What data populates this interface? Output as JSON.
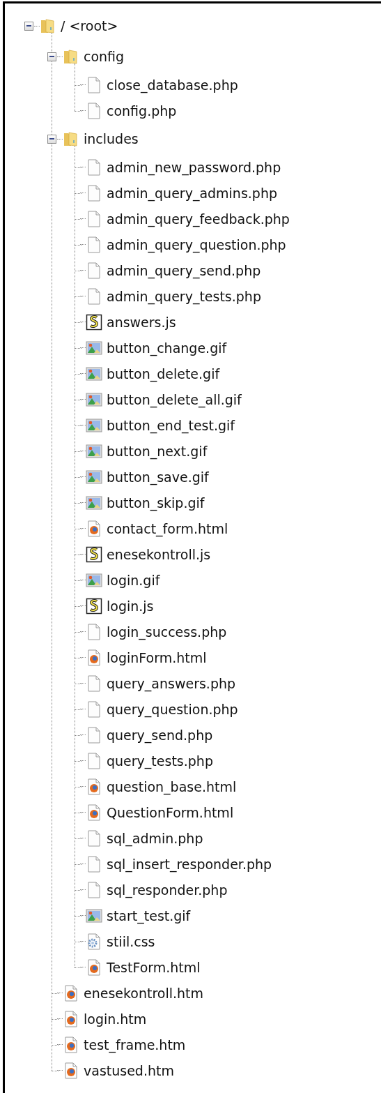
{
  "tree": {
    "label": "/ <root>",
    "kind": "folder",
    "expanded": true,
    "children": [
      {
        "label": "config",
        "kind": "folder",
        "expanded": true,
        "children": [
          {
            "label": "close_database.php",
            "kind": "php"
          },
          {
            "label": "config.php",
            "kind": "php"
          }
        ]
      },
      {
        "label": "includes",
        "kind": "folder",
        "expanded": true,
        "children": [
          {
            "label": "admin_new_password.php",
            "kind": "php"
          },
          {
            "label": "admin_query_admins.php",
            "kind": "php"
          },
          {
            "label": "admin_query_feedback.php",
            "kind": "php"
          },
          {
            "label": "admin_query_question.php",
            "kind": "php"
          },
          {
            "label": "admin_query_send.php",
            "kind": "php"
          },
          {
            "label": "admin_query_tests.php",
            "kind": "php"
          },
          {
            "label": "answers.js",
            "kind": "js"
          },
          {
            "label": "button_change.gif",
            "kind": "gif"
          },
          {
            "label": "button_delete.gif",
            "kind": "gif"
          },
          {
            "label": "button_delete_all.gif",
            "kind": "gif"
          },
          {
            "label": "button_end_test.gif",
            "kind": "gif"
          },
          {
            "label": "button_next.gif",
            "kind": "gif"
          },
          {
            "label": "button_save.gif",
            "kind": "gif"
          },
          {
            "label": "button_skip.gif",
            "kind": "gif"
          },
          {
            "label": "contact_form.html",
            "kind": "html"
          },
          {
            "label": "enesekontroll.js",
            "kind": "js"
          },
          {
            "label": "login.gif",
            "kind": "gif"
          },
          {
            "label": "login.js",
            "kind": "js"
          },
          {
            "label": "login_success.php",
            "kind": "php"
          },
          {
            "label": "loginForm.html",
            "kind": "html"
          },
          {
            "label": "query_answers.php",
            "kind": "php"
          },
          {
            "label": "query_question.php",
            "kind": "php"
          },
          {
            "label": "query_send.php",
            "kind": "php"
          },
          {
            "label": "query_tests.php",
            "kind": "php"
          },
          {
            "label": "question_base.html",
            "kind": "html"
          },
          {
            "label": "QuestionForm.html",
            "kind": "html"
          },
          {
            "label": "sql_admin.php",
            "kind": "php"
          },
          {
            "label": "sql_insert_responder.php",
            "kind": "php"
          },
          {
            "label": "sql_responder.php",
            "kind": "php"
          },
          {
            "label": "start_test.gif",
            "kind": "gif"
          },
          {
            "label": "stiil.css",
            "kind": "css"
          },
          {
            "label": "TestForm.html",
            "kind": "html"
          }
        ]
      },
      {
        "label": "enesekontroll.htm",
        "kind": "html"
      },
      {
        "label": "login.htm",
        "kind": "html"
      },
      {
        "label": "test_frame.htm",
        "kind": "html"
      },
      {
        "label": "vastused.htm",
        "kind": "html"
      }
    ]
  }
}
